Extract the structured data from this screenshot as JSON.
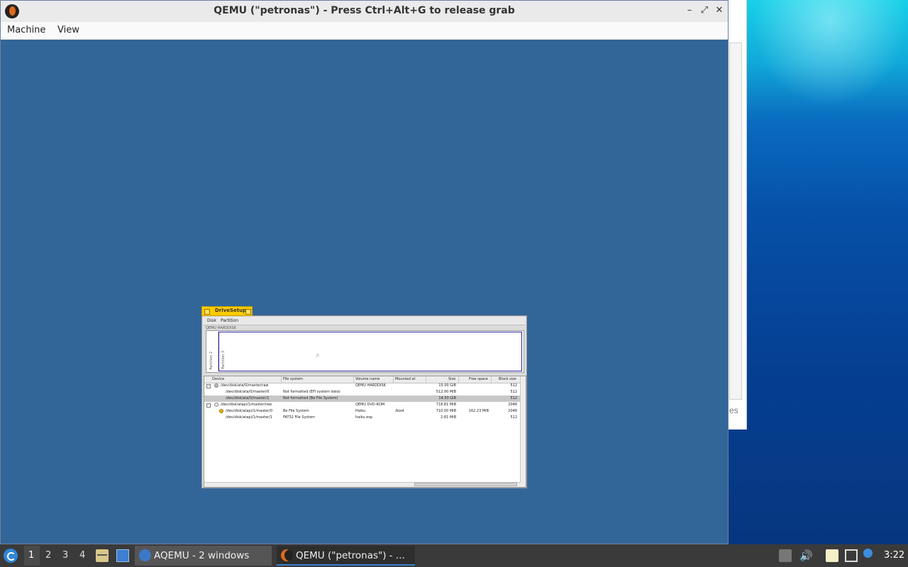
{
  "qemu": {
    "title": "QEMU (\"petronas\") - Press Ctrl+Alt+G to release grab",
    "menu": [
      "Machine",
      "View"
    ],
    "buttons": {
      "minimize": "–",
      "maximize": "⤢",
      "close": "✕"
    }
  },
  "background_window": {
    "tail_text": "es"
  },
  "drivesetup": {
    "tab_title": "DriveSetup",
    "menu": [
      "Disk",
      "Partition"
    ],
    "disk_label": "QEMU HARDDISK",
    "partition_labels": [
      "Partition 2",
      "Partition 3"
    ],
    "columns": [
      "Device",
      "File system",
      "Volume name",
      "Mounted at",
      "Size",
      "Free space",
      "Block size"
    ],
    "rows": [
      {
        "device": "/dev/disk/ata/0/master/raw",
        "fs": "",
        "volume": "QEMU HARDDISK",
        "mounted": "",
        "size": "15.00 GiB",
        "free": "",
        "block": "512",
        "level": 0,
        "expander": "−",
        "icon": "hdd"
      },
      {
        "device": "/dev/disk/ata/0/master/0",
        "fs": "Not formatted (EFI system data)",
        "volume": "",
        "mounted": "",
        "size": "512.00 MiB",
        "free": "",
        "block": "512",
        "level": 1
      },
      {
        "device": "/dev/disk/ata/0/master/1",
        "fs": "Not formatted (Be File System)",
        "volume": "",
        "mounted": "",
        "size": "14.50 GiB",
        "free": "",
        "block": "512",
        "level": 1,
        "selected": true
      },
      {
        "device": "/dev/disk/atapi/1/master/raw",
        "fs": "",
        "volume": "QEMU DVD-ROM",
        "mounted": "",
        "size": "718.81 MiB",
        "free": "",
        "block": "2048",
        "level": 0,
        "expander": "−",
        "icon": "cd"
      },
      {
        "device": "/dev/disk/atapi/1/master/0",
        "fs": "Be File System",
        "volume": "Haiku",
        "mounted": "/boot",
        "size": "710.00 MiB",
        "free": "162.23 MiB",
        "block": "2048",
        "level": 1,
        "icon": "bfs"
      },
      {
        "device": "/dev/disk/atapi/1/master/1",
        "fs": "FAT32 File System",
        "volume": "haiku esp",
        "mounted": "",
        "size": "2.81 MiB",
        "free": "",
        "block": "512",
        "level": 1
      }
    ]
  },
  "taskbar": {
    "workspaces": [
      "1",
      "2",
      "3",
      "4"
    ],
    "active_workspace": "1",
    "tasks": [
      {
        "label": "AQEMU - 2 windows",
        "icon": "aqemu-icon",
        "active": false
      },
      {
        "label": "QEMU (\"petronas\") - ...",
        "icon": "qemu-icon",
        "active": true
      }
    ],
    "clock": "3:22"
  },
  "colors": {
    "qemu_screen": "#336698",
    "haiku_tab": "#ffcb00",
    "taskbar": "#3a3a3a"
  }
}
